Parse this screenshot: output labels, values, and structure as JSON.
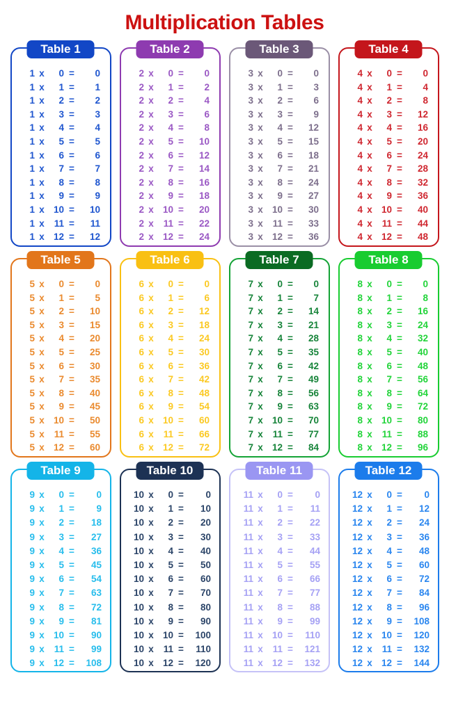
{
  "page": {
    "title": "Multiplication Tables",
    "title_color": "#cc1111",
    "background": "#ffffff"
  },
  "symbols": {
    "times": "x",
    "equals": "="
  },
  "tables": [
    {
      "label": "Table 1",
      "factor": "1",
      "color": "#1247c6",
      "badge_color": "#1247c6",
      "border_color": "#1247c6",
      "text_color": "#1f56cf",
      "multipliers": [
        "0",
        "1",
        "2",
        "3",
        "4",
        "5",
        "6",
        "7",
        "8",
        "9",
        "10",
        "11",
        "12"
      ],
      "products": [
        "0",
        "1",
        "2",
        "3",
        "4",
        "5",
        "6",
        "7",
        "8",
        "9",
        "10",
        "11",
        "12"
      ]
    },
    {
      "label": "Table 2",
      "factor": "2",
      "color": "#8e3bb0",
      "badge_color": "#8e3bb0",
      "border_color": "#8e3bb0",
      "text_color": "#9a58c4",
      "multipliers": [
        "0",
        "1",
        "2",
        "3",
        "4",
        "5",
        "6",
        "7",
        "8",
        "9",
        "10",
        "11",
        "12"
      ],
      "products": [
        "0",
        "2",
        "4",
        "6",
        "8",
        "10",
        "12",
        "14",
        "16",
        "18",
        "20",
        "22",
        "24"
      ]
    },
    {
      "label": "Table 3",
      "factor": "3",
      "color": "#6b5878",
      "badge_color": "#6b5878",
      "border_color": "#9a8fa6",
      "text_color": "#7d6f8c",
      "multipliers": [
        "0",
        "1",
        "2",
        "3",
        "4",
        "5",
        "6",
        "7",
        "8",
        "9",
        "10",
        "11",
        "12"
      ],
      "products": [
        "0",
        "3",
        "6",
        "9",
        "12",
        "15",
        "18",
        "21",
        "24",
        "27",
        "30",
        "33",
        "36"
      ]
    },
    {
      "label": "Table 4",
      "factor": "4",
      "color": "#c4161c",
      "badge_color": "#c4161c",
      "border_color": "#c4161c",
      "text_color": "#cf2730",
      "multipliers": [
        "0",
        "1",
        "2",
        "3",
        "4",
        "5",
        "6",
        "7",
        "8",
        "9",
        "10",
        "11",
        "12"
      ],
      "products": [
        "0",
        "4",
        "8",
        "12",
        "16",
        "20",
        "24",
        "28",
        "32",
        "36",
        "40",
        "44",
        "48"
      ]
    },
    {
      "label": "Table 5",
      "factor": "5",
      "color": "#e2761b",
      "badge_color": "#e2761b",
      "border_color": "#e2761b",
      "text_color": "#ea8a2e",
      "multipliers": [
        "0",
        "1",
        "2",
        "3",
        "4",
        "5",
        "6",
        "7",
        "8",
        "9",
        "10",
        "11",
        "12"
      ],
      "products": [
        "0",
        "5",
        "10",
        "15",
        "20",
        "25",
        "30",
        "35",
        "40",
        "45",
        "50",
        "55",
        "60"
      ]
    },
    {
      "label": "Table 6",
      "factor": "6",
      "color": "#f9c013",
      "badge_color": "#f9c013",
      "border_color": "#f9c013",
      "text_color": "#fbc923",
      "multipliers": [
        "0",
        "1",
        "2",
        "3",
        "4",
        "5",
        "6",
        "7",
        "8",
        "9",
        "10",
        "11",
        "12"
      ],
      "products": [
        "0",
        "6",
        "12",
        "18",
        "24",
        "30",
        "36",
        "42",
        "48",
        "54",
        "60",
        "66",
        "72"
      ]
    },
    {
      "label": "Table 7",
      "factor": "7",
      "color": "#0b6b23",
      "badge_color": "#0b6b23",
      "border_color": "#14a336",
      "text_color": "#17843a",
      "multipliers": [
        "0",
        "1",
        "2",
        "3",
        "4",
        "5",
        "6",
        "7",
        "8",
        "9",
        "10",
        "11",
        "12"
      ],
      "products": [
        "0",
        "7",
        "14",
        "21",
        "28",
        "35",
        "42",
        "49",
        "56",
        "63",
        "70",
        "77",
        "84"
      ]
    },
    {
      "label": "Table 8",
      "factor": "8",
      "color": "#18cc30",
      "badge_color": "#18cc30",
      "border_color": "#18cc30",
      "text_color": "#22d43a",
      "multipliers": [
        "0",
        "1",
        "2",
        "3",
        "4",
        "5",
        "6",
        "7",
        "8",
        "9",
        "10",
        "11",
        "12"
      ],
      "products": [
        "0",
        "8",
        "16",
        "24",
        "32",
        "40",
        "48",
        "56",
        "64",
        "72",
        "80",
        "88",
        "96"
      ]
    },
    {
      "label": "Table 9",
      "factor": "9",
      "color": "#14b4e8",
      "badge_color": "#14b4e8",
      "border_color": "#14b4e8",
      "text_color": "#27bdec",
      "multipliers": [
        "0",
        "1",
        "2",
        "3",
        "4",
        "5",
        "6",
        "7",
        "8",
        "9",
        "10",
        "11",
        "12"
      ],
      "products": [
        "0",
        "9",
        "18",
        "27",
        "36",
        "45",
        "54",
        "63",
        "72",
        "81",
        "90",
        "99",
        "108"
      ]
    },
    {
      "label": "Table 10",
      "factor": "10",
      "color": "#1d3254",
      "badge_color": "#1d3254",
      "border_color": "#1d3254",
      "text_color": "#2b4468",
      "multipliers": [
        "0",
        "1",
        "2",
        "3",
        "4",
        "5",
        "6",
        "7",
        "8",
        "9",
        "10",
        "11",
        "12"
      ],
      "products": [
        "0",
        "10",
        "20",
        "30",
        "40",
        "50",
        "60",
        "70",
        "80",
        "90",
        "100",
        "110",
        "120"
      ]
    },
    {
      "label": "Table 11",
      "factor": "11",
      "color": "#9a96f2",
      "badge_color": "#9a96f2",
      "border_color": "#c5c2f7",
      "text_color": "#a5a1f4",
      "multipliers": [
        "0",
        "1",
        "2",
        "3",
        "4",
        "5",
        "6",
        "7",
        "8",
        "9",
        "10",
        "11",
        "12"
      ],
      "products": [
        "0",
        "11",
        "22",
        "33",
        "44",
        "55",
        "66",
        "77",
        "88",
        "99",
        "110",
        "121",
        "132"
      ]
    },
    {
      "label": "Table 12",
      "factor": "12",
      "color": "#1c7ceb",
      "badge_color": "#1c7ceb",
      "border_color": "#1c7ceb",
      "text_color": "#2a86ef",
      "multipliers": [
        "0",
        "1",
        "2",
        "3",
        "4",
        "5",
        "6",
        "7",
        "8",
        "9",
        "10",
        "11",
        "12"
      ],
      "products": [
        "0",
        "12",
        "24",
        "36",
        "48",
        "60",
        "72",
        "84",
        "96",
        "108",
        "120",
        "132",
        "144"
      ]
    }
  ]
}
